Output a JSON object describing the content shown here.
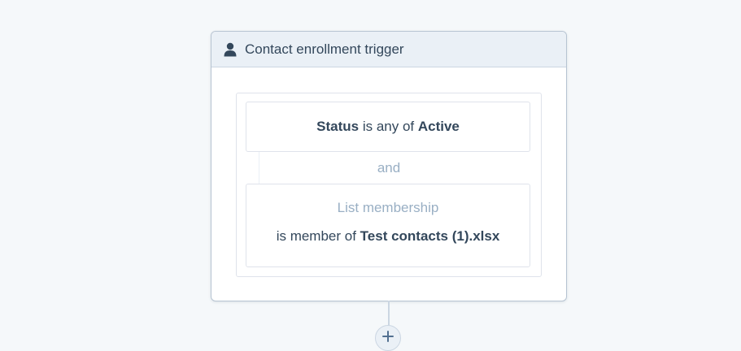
{
  "trigger": {
    "title": "Contact enrollment trigger",
    "icon": "person-icon"
  },
  "filters": [
    {
      "property": "Status",
      "operator": "is any of",
      "value": "Active"
    },
    {
      "property": "List membership",
      "operator": "is member of",
      "value": "Test contacts (1).xlsx"
    }
  ],
  "connector_label": "and",
  "add_action": {
    "icon": "plus-icon"
  },
  "colors": {
    "background": "#f5f8fa",
    "header": "#eaf0f6",
    "text": "#33475b",
    "muted": "#99afc4",
    "border": "#cbd6e2"
  }
}
